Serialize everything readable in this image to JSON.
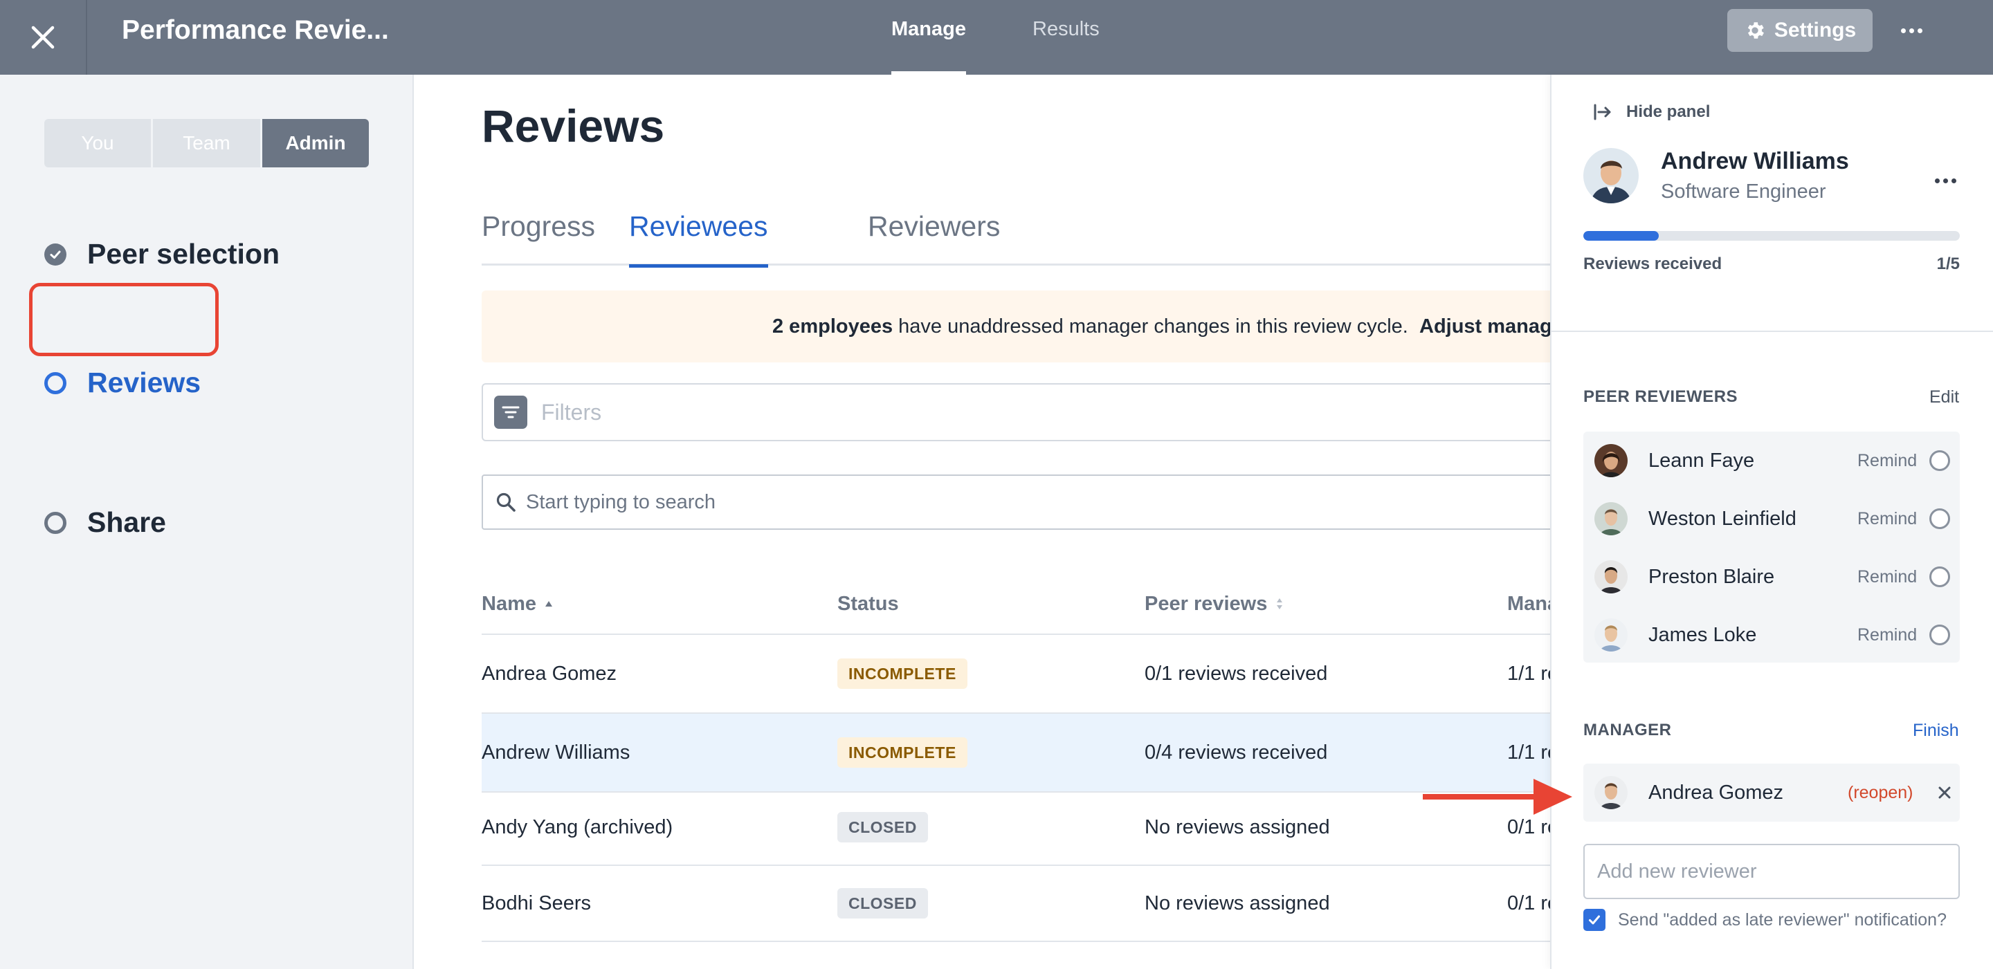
{
  "header": {
    "title": "Performance Revie...",
    "tabs": [
      {
        "label": "Manage",
        "active": true
      },
      {
        "label": "Results",
        "active": false
      }
    ],
    "settings_label": "Settings",
    "icons": {
      "close": "close-icon",
      "settings": "gear-icon",
      "more": "more-horizontal-icon"
    }
  },
  "sidebar": {
    "segments": [
      {
        "label": "You",
        "active": false
      },
      {
        "label": "Team",
        "active": false
      },
      {
        "label": "Admin",
        "active": true
      }
    ],
    "steps": [
      {
        "label": "Peer selection",
        "state": "completed"
      },
      {
        "label": "Reviews",
        "state": "current"
      },
      {
        "label": "Share",
        "state": "pending"
      }
    ]
  },
  "main": {
    "title": "Reviews",
    "tabs": [
      {
        "label": "Progress",
        "active": false
      },
      {
        "label": "Reviewees",
        "active": true
      },
      {
        "label": "Reviewers",
        "active": false
      }
    ],
    "banner": {
      "count_text": "2 employees",
      "message": " have unaddressed manager changes in this review cycle.",
      "action": "Adjust manag"
    },
    "filters_label": "Filters",
    "search_placeholder": "Start typing to search",
    "table": {
      "columns": [
        "Name",
        "Status",
        "Peer reviews",
        "Mana"
      ],
      "rows": [
        {
          "name": "Andrea Gomez",
          "status": "INCOMPLETE",
          "peer": "0/1 reviews received",
          "manager": "1/1 re",
          "highlighted": false
        },
        {
          "name": "Andrew Williams",
          "status": "INCOMPLETE",
          "peer": "0/4 reviews received",
          "manager": "1/1 re",
          "highlighted": true
        },
        {
          "name": "Andy Yang (archived)",
          "status": "CLOSED",
          "peer": "No reviews assigned",
          "manager": "0/1 re",
          "highlighted": false
        },
        {
          "name": "Bodhi Seers",
          "status": "CLOSED",
          "peer": "No reviews assigned",
          "manager": "0/1 re",
          "highlighted": false
        }
      ]
    }
  },
  "panel": {
    "hide_label": "Hide panel",
    "person": {
      "name": "Andrew Williams",
      "role": "Software Engineer"
    },
    "reviews_received_label": "Reviews received",
    "reviews_received_count": "1/5",
    "reviews_received_fraction": 0.2,
    "peer_section": {
      "title": "PEER REVIEWERS",
      "action": "Edit"
    },
    "peer_reviewers": [
      {
        "name": "Leann Faye",
        "action": "Remind"
      },
      {
        "name": "Weston Leinfield",
        "action": "Remind"
      },
      {
        "name": "Preston Blaire",
        "action": "Remind"
      },
      {
        "name": "James Loke",
        "action": "Remind"
      }
    ],
    "manager_section": {
      "title": "MANAGER",
      "action": "Finish"
    },
    "manager": {
      "name": "Andrea Gomez",
      "status": "(reopen)"
    },
    "add_placeholder": "Add new reviewer",
    "notify_label": "Send \"added as late reviewer\" notification?",
    "notify_checked": true
  },
  "colors": {
    "topbar": "#6b7584",
    "accent": "#2563c9",
    "highlight_row": "#eaf3fd",
    "annotation": "#e84434"
  }
}
